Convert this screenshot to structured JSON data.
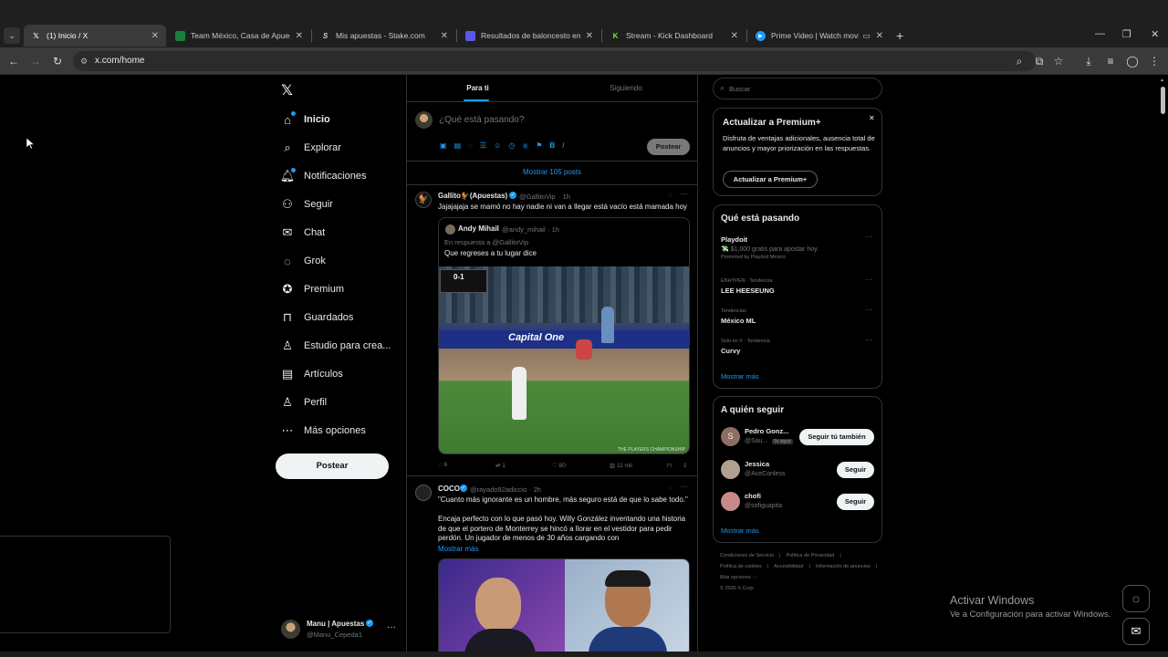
{
  "browser": {
    "tabs": [
      {
        "label": "(1) Inicio / X",
        "icon": "x-logo-icon",
        "color": "#ffffff",
        "active": true
      },
      {
        "label": "Team México, Casa de Apuestas",
        "icon": "team-mexico-icon",
        "color": "#1b7f3a"
      },
      {
        "label": "Mis apuestas - Stake.com",
        "icon": "stake-icon",
        "color": "#cccccc"
      },
      {
        "label": "Resultados de baloncesto en di",
        "icon": "resultados-icon",
        "color": "#6a6af0"
      },
      {
        "label": "Stream - Kick Dashboard",
        "icon": "kick-icon",
        "color": "#53fc18"
      },
      {
        "label": "Prime Video | Watch movie",
        "icon": "prime-video-icon",
        "color": "#1a98ff"
      }
    ],
    "url": "x.com/home"
  },
  "left_nav": {
    "items": [
      {
        "label": "Inicio",
        "icon": "home-icon",
        "bold": true
      },
      {
        "label": "Explorar",
        "icon": "search-icon"
      },
      {
        "label": "Notificaciones",
        "icon": "bell-icon"
      },
      {
        "label": "Seguir",
        "icon": "follow-icon"
      },
      {
        "label": "Chat",
        "icon": "mail-icon"
      },
      {
        "label": "Grok",
        "icon": "grok-icon"
      },
      {
        "label": "Premium",
        "icon": "premium-icon"
      },
      {
        "label": "Guardados",
        "icon": "bookmark-icon"
      },
      {
        "label": "Estudio para crea...",
        "icon": "studio-icon"
      },
      {
        "label": "Artículos",
        "icon": "articles-icon"
      },
      {
        "label": "Perfil",
        "icon": "profile-icon"
      },
      {
        "label": "Más opciones",
        "icon": "more-icon"
      }
    ],
    "post_button": "Postear",
    "account": {
      "name": "Manu | Apuestas",
      "handle": "@Manu_Cepeda1"
    }
  },
  "feed": {
    "tabs": [
      "Para ti",
      "Siguiendo"
    ],
    "composer_placeholder": "¿Qué está pasando?",
    "composer_post": "Postear",
    "show_more_posts": "Mostrar 105 posts",
    "posts": [
      {
        "name": "Gallito🐓(Apuestas)",
        "handle": "@GallitoVip",
        "time": "· 1h",
        "text": "Jajajajaja se mamó no hay nadie ni van a llegar está vacío está mamada hoy",
        "quote": {
          "name": "Andy Mihail",
          "handle": "@andy_mihail",
          "time": "· 1h",
          "reply_to": "En respuesta a @GallitoVip",
          "text": "Que regreses a tu lugar dice",
          "scoreboard": "0-1",
          "banner": "Capital One",
          "caption": "THE PLAYERS CHAMPIONSHIP"
        },
        "stats": {
          "replies": "6",
          "reposts": "1",
          "likes": "80",
          "views": "11 mil"
        }
      },
      {
        "name": "COCO",
        "handle": "@rayado92adiccio",
        "time": "· 2h",
        "text1": "\"Cuanto más ignorante es un hombre, más seguro está de que lo sabe todo.\"",
        "text2": "Encaja perfecto con lo que pasó hoy. Willy González inventando una historia de que el portero de Monterrey se hincó a llorar en el vestidor para pedir perdón. Un jugador de menos de 30 años cargando con",
        "show_more": "Mostrar más"
      }
    ]
  },
  "right": {
    "search_placeholder": "Buscar",
    "premium": {
      "title": "Actualizar a Premium+",
      "text": "Disfruta de ventajas adicionales, ausencia total de anuncios y mayor priorización en las respuestas.",
      "button": "Actualizar a Premium+"
    },
    "trends": {
      "title": "Qué está pasando",
      "items": [
        {
          "context": "",
          "title": "Playdoit",
          "sub": "💸 $1,000 gratis para apostar hoy.",
          "promo": "Promoted by Playdoit México"
        },
        {
          "context": "ENHYPEN · Tendencia",
          "title": "LEE HEESEUNG"
        },
        {
          "context": "Tendencias",
          "title": "México ML"
        },
        {
          "context": "Solo en X · Tendencia",
          "title": "Curvy"
        }
      ],
      "show_more": "Mostrar más"
    },
    "who_to_follow": {
      "title": "A quién seguir",
      "items": [
        {
          "name": "Pedro Gonz...",
          "handle": "@Sau...",
          "badge": "Te sigue",
          "button": "Seguir tú también",
          "avatar_letter": "S",
          "avatar_color": "#8d6e63"
        },
        {
          "name": "Jessica",
          "handle": "@AceConless",
          "button": "Seguir",
          "avatar_color": "#b0a090"
        },
        {
          "name": "chofi",
          "handle": "@sofiguapita",
          "button": "Seguir",
          "avatar_color": "#c78a8a"
        }
      ],
      "show_more": "Mostrar más"
    },
    "footer": {
      "links": [
        "Condiciones de Servicio",
        "Política de Privacidad",
        "Política de cookies",
        "Accesibilidad",
        "Información de anuncios",
        "Más opciones ···"
      ],
      "copyright": "© 2026 X Corp."
    }
  },
  "watermark": {
    "line1": "Activar Windows",
    "line2": "Ve a Configuración para activar Windows."
  },
  "colors": {
    "accent": "#1d9bf0",
    "background": "#000000",
    "border": "#2f3336"
  }
}
